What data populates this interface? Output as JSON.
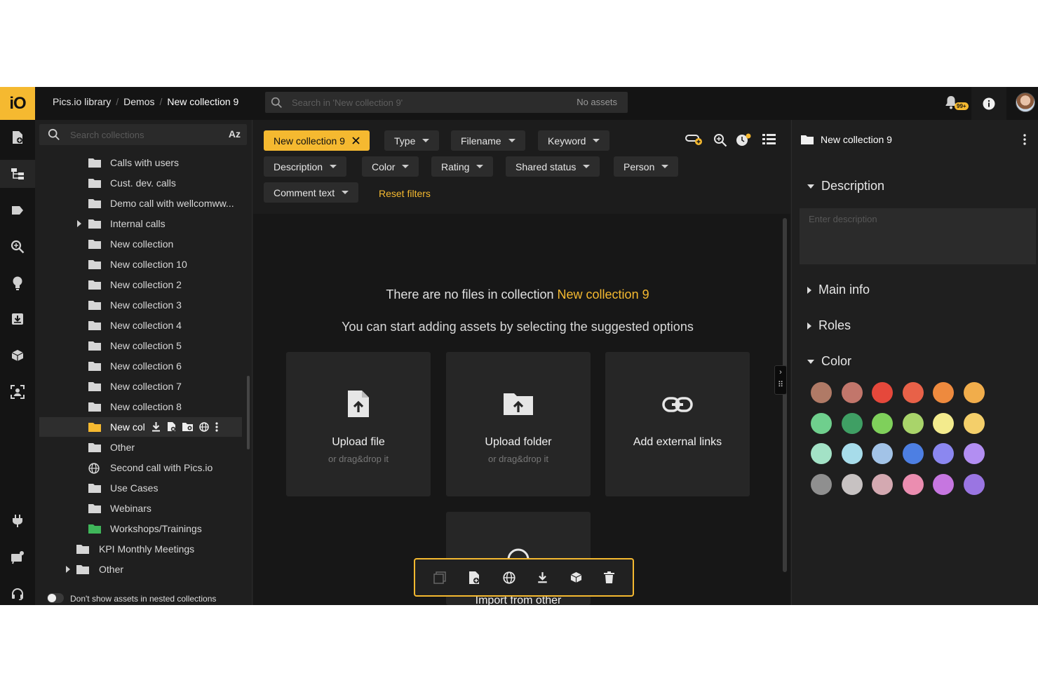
{
  "topbar": {
    "logo": "iO",
    "breadcrumb": [
      "Pics.io library",
      "Demos",
      "New collection 9"
    ],
    "search_placeholder": "Search in 'New collection 9'",
    "asset_count": "No assets",
    "notification_badge": "99+"
  },
  "tree": {
    "search_placeholder": "Search collections",
    "sort_label": "Az",
    "items": [
      {
        "label": "Calls with users"
      },
      {
        "label": "Cust. dev. calls"
      },
      {
        "label": "Demo call with wellcomww..."
      },
      {
        "label": "Internal calls"
      },
      {
        "label": "New collection"
      },
      {
        "label": "New collection 10"
      },
      {
        "label": "New collection 2"
      },
      {
        "label": "New collection 3"
      },
      {
        "label": "New collection 4"
      },
      {
        "label": "New collection 5"
      },
      {
        "label": "New collection 6"
      },
      {
        "label": "New collection 7"
      },
      {
        "label": "New collection 8"
      },
      {
        "label": "New col"
      },
      {
        "label": "Other"
      },
      {
        "label": "Second call with Pics.io"
      },
      {
        "label": "Use Cases"
      },
      {
        "label": "Webinars"
      },
      {
        "label": "Workshops/Trainings"
      },
      {
        "label": "KPI Monthly Meetings"
      },
      {
        "label": "Other"
      }
    ],
    "nested_toggle_label": "Don't show assets in nested collections"
  },
  "filters": {
    "active_chip": "New collection 9",
    "chips": [
      "Type",
      "Filename",
      "Keyword",
      "Description",
      "Color",
      "Rating",
      "Shared status",
      "Person",
      "Comment text"
    ],
    "reset_label": "Reset filters"
  },
  "content": {
    "empty_prefix": "There are no files in collection ",
    "empty_collection": "New collection 9",
    "suggest": "You can start adding assets by selecting the suggested options",
    "cards": [
      {
        "title": "Upload file",
        "sub": "or drag&drop it"
      },
      {
        "title": "Upload folder",
        "sub": "or drag&drop it"
      },
      {
        "title": "Add external links",
        "sub": ""
      },
      {
        "title": "Import from other",
        "sub": ""
      }
    ]
  },
  "right_panel": {
    "title": "New collection 9",
    "description_label": "Description",
    "description_placeholder": "Enter description",
    "main_info_label": "Main info",
    "roles_label": "Roles",
    "color_label": "Color",
    "colors": [
      "#b07a66",
      "#c2766b",
      "#e5483b",
      "#e86148",
      "#ee8a3e",
      "#f1ad4b",
      "#6fcf8d",
      "#3f9f64",
      "#7fd05b",
      "#a9d46a",
      "#f3eb8d",
      "#f4cf6a",
      "#a3e2c6",
      "#a7dcea",
      "#a2c3e7",
      "#4d7fe3",
      "#8b87f0",
      "#b28ef2",
      "#8f8f8f",
      "#c7c2c2",
      "#d4a9b1",
      "#eb8db0",
      "#c676e0",
      "#9a75e2"
    ]
  }
}
